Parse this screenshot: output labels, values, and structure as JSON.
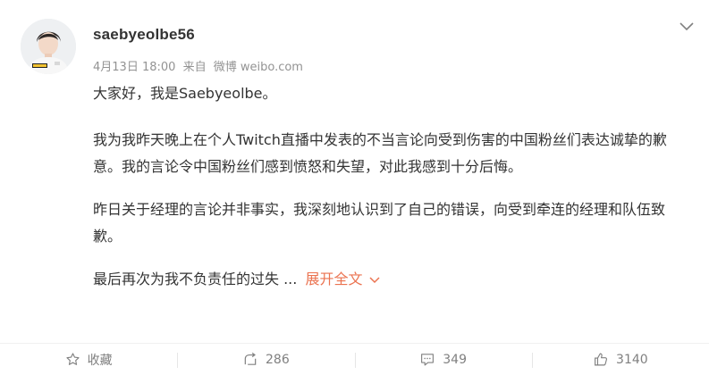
{
  "post": {
    "username": "saebyeolbe56",
    "date": "4月13日 18:00",
    "source_prefix": "来自",
    "source": "微博 weibo.com",
    "paragraphs": [
      "大家好，我是Saebyeolbe。",
      "我为我昨天晚上在个人Twitch直播中发表的不当言论向受到伤害的中国粉丝们表达诚挚的歉意。我的言论令中国粉丝们感到愤怒和失望，对此我感到十分后悔。",
      "昨日关于经理的言论并非事实，我深刻地认识到了自己的错误，向受到牵连的经理和队伍致歉。"
    ],
    "truncated_text": "最后再次为我不负责任的过失 ...",
    "expand_label": "展开全文"
  },
  "actions": {
    "favorite_label": "收藏",
    "repost_count": "286",
    "comment_count": "349",
    "like_count": "3140"
  },
  "colors": {
    "accent": "#eb7350",
    "meta_text": "#939393",
    "body_text": "#333333"
  },
  "icons": [
    "avatar",
    "chevron-down-icon",
    "star-icon",
    "repost-icon",
    "comment-icon",
    "like-icon"
  ]
}
